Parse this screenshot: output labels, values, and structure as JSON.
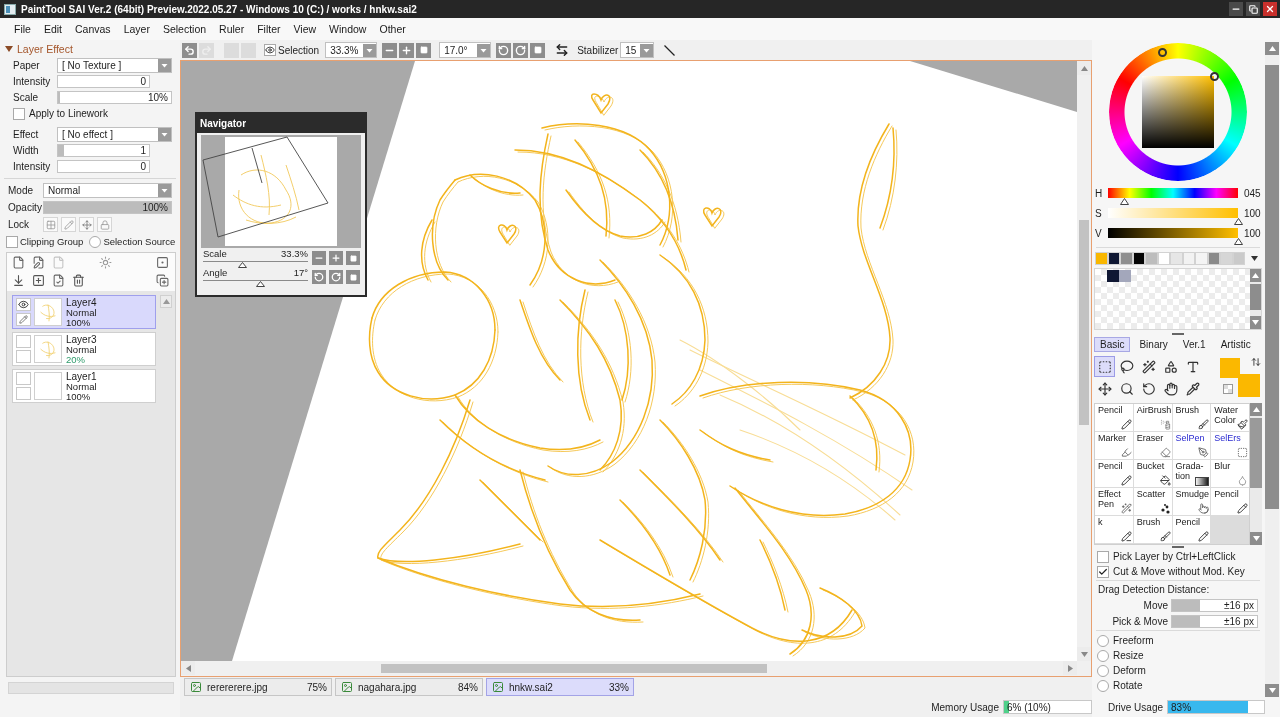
{
  "window": {
    "title": "PaintTool SAI Ver.2 (64bit) Preview.2022.05.27 - Windows 10 (C:) / works / hnkw.sai2"
  },
  "menu": [
    "File",
    "Edit",
    "Canvas",
    "Layer",
    "Selection",
    "Ruler",
    "Filter",
    "View",
    "Window",
    "Other"
  ],
  "toolbar": {
    "history": [
      {
        "kind": "undo",
        "disabled": false
      },
      {
        "kind": "redo",
        "disabled": true
      },
      {
        "kind": "blank",
        "disabled": true
      },
      {
        "kind": "blank",
        "disabled": true
      }
    ],
    "selection": {
      "label": "Selection",
      "checked": true
    },
    "zoom": "33.3%",
    "angle": "17.0°",
    "stabilizer": {
      "label": "Stabilizer",
      "value": "15"
    }
  },
  "layer_effect": {
    "title": "Layer Effect",
    "expanded": true,
    "fields": [
      {
        "kind": "dropdown",
        "label": "Paper",
        "value": "[ No Texture ]"
      },
      {
        "kind": "number",
        "label": "Intensity",
        "value": "0"
      },
      {
        "kind": "slider",
        "label": "Scale",
        "value": "10%",
        "level": 0.02
      },
      {
        "kind": "checkbox",
        "label": "Apply to Linework",
        "checked": false
      },
      {
        "kind": "dropdown",
        "label": "Effect",
        "value": "[ No effect ]"
      },
      {
        "kind": "number",
        "label": "Width",
        "value": "1",
        "level": 0.07
      },
      {
        "kind": "number",
        "label": "Intensity",
        "value": "0"
      }
    ]
  },
  "layer_props": {
    "mode": {
      "label": "Mode",
      "value": "Normal"
    },
    "opacity": {
      "label": "Opacity",
      "value": "100%",
      "level": 1
    },
    "lock_label": "Lock",
    "clipping_group": {
      "label": "Clipping Group",
      "checked": false
    },
    "selection_source": {
      "label": "Selection Source",
      "selected": false
    }
  },
  "layers": [
    {
      "name": "Layer4",
      "mode": "Normal",
      "opacity": "100%",
      "opacity_changed": false,
      "visible": true,
      "editing": true,
      "selected": true,
      "empty": false
    },
    {
      "name": "Layer3",
      "mode": "Normal",
      "opacity": "20%",
      "opacity_changed": true,
      "visible": false,
      "editing": false,
      "selected": false,
      "empty": false
    },
    {
      "name": "Layer1",
      "mode": "Normal",
      "opacity": "100%",
      "opacity_changed": false,
      "visible": false,
      "editing": false,
      "selected": false,
      "empty": true
    }
  ],
  "navigator": {
    "title": "Navigator",
    "scale": {
      "label": "Scale",
      "value": "33.3%",
      "level": 0.38
    },
    "angle": {
      "label": "Angle",
      "value": "17°",
      "level": 0.55
    }
  },
  "file_tabs": [
    {
      "name": "rerererere.jpg",
      "zoom": "75%",
      "selected": false
    },
    {
      "name": "nagahara.jpg",
      "zoom": "84%",
      "selected": false
    },
    {
      "name": "hnkw.sai2",
      "zoom": "33%",
      "selected": true
    }
  ],
  "memory": {
    "label": "Memory Usage",
    "value": "6% (10%)",
    "level": 0.06
  },
  "color": {
    "hsv": [
      {
        "label": "H",
        "value": "045",
        "level": 0.125
      },
      {
        "label": "S",
        "value": "100",
        "level": 1
      },
      {
        "label": "V",
        "value": "100",
        "level": 1
      }
    ],
    "swatches": [
      {
        "color": "#f9b700"
      },
      {
        "color": "#0f1733"
      },
      {
        "color": "#8e8e8e"
      },
      {
        "color": "#050505"
      },
      {
        "color": "#bdbdbd"
      },
      {
        "color": "#ffffff"
      },
      {
        "color": "#e6e6e6"
      },
      {
        "color": "#f2f2f2"
      },
      {
        "color": "#f4f4f4"
      },
      {
        "color": "#8a8a8a"
      },
      {
        "color": "#d6d6d6"
      },
      {
        "color": "#cacaca"
      }
    ],
    "custom_swatches": [
      {
        "color": "#0f1733"
      },
      {
        "color": "#a3a7bb"
      }
    ],
    "current": [
      {
        "color": "#fbb800"
      },
      {
        "color": "#fbb800"
      }
    ]
  },
  "tool_tabs": [
    {
      "label": "Basic",
      "selected": true
    },
    {
      "label": "Binary",
      "selected": false
    },
    {
      "label": "Ver.1",
      "selected": false
    },
    {
      "label": "Artistic",
      "selected": false
    }
  ],
  "tools": [
    {
      "kind": "rect-select",
      "selected": true
    },
    {
      "kind": "lasso",
      "selected": false
    },
    {
      "kind": "magic-wand",
      "selected": false
    },
    {
      "kind": "shape",
      "selected": false
    },
    {
      "kind": "text",
      "selected": false
    },
    {
      "kind": "move",
      "selected": false
    },
    {
      "kind": "zoom",
      "selected": false
    },
    {
      "kind": "rotate",
      "selected": false
    },
    {
      "kind": "hand",
      "selected": false
    },
    {
      "kind": "eyedropper",
      "selected": false
    }
  ],
  "brushes": [
    {
      "label": "Pencil",
      "kind": "pencil"
    },
    {
      "label": "AirBrush",
      "kind": "airbrush"
    },
    {
      "label": "Brush",
      "kind": "brush"
    },
    {
      "label": "Water\nColor",
      "kind": "watercolor"
    },
    {
      "label": "Marker",
      "kind": "marker"
    },
    {
      "label": "Eraser",
      "kind": "eraser"
    },
    {
      "label": "SelPen",
      "kind": "selpen"
    },
    {
      "label": "SelErs",
      "kind": "selers"
    },
    {
      "label": "Pencil",
      "kind": "pencil"
    },
    {
      "label": "Bucket",
      "kind": "bucket"
    },
    {
      "label": "Grada-\ntion",
      "kind": "gradation"
    },
    {
      "label": "Blur",
      "kind": "blur"
    },
    {
      "label": "Effect\nPen",
      "kind": "effectpen"
    },
    {
      "label": "Scatter",
      "kind": "scatter"
    },
    {
      "label": "Smudge",
      "kind": "smudge"
    },
    {
      "label": "Pencil",
      "kind": "pencil"
    },
    {
      "label": "k",
      "kind": "pencil-square"
    },
    {
      "label": "Brush",
      "kind": "brush"
    },
    {
      "label": "Pencil",
      "kind": "pencil"
    }
  ],
  "options": {
    "checks": [
      {
        "label": "Pick Layer by Ctrl+LeftClick",
        "checked": false
      },
      {
        "label": "Cut & Move without Mod. Key",
        "checked": true
      }
    ],
    "drag_title": "Drag Detection Distance:",
    "drag": [
      {
        "label": "Move",
        "value": "±16 px",
        "level": 0.33
      },
      {
        "label": "Pick & Move",
        "value": "±16 px",
        "level": 0.33
      }
    ],
    "transforms": [
      {
        "label": "Freeform",
        "selected": false
      },
      {
        "label": "Resize",
        "selected": false
      },
      {
        "label": "Deform",
        "selected": false
      },
      {
        "label": "Rotate",
        "selected": false
      }
    ]
  },
  "drive": {
    "label": "Drive Usage",
    "value": "83%",
    "level": 0.83
  }
}
